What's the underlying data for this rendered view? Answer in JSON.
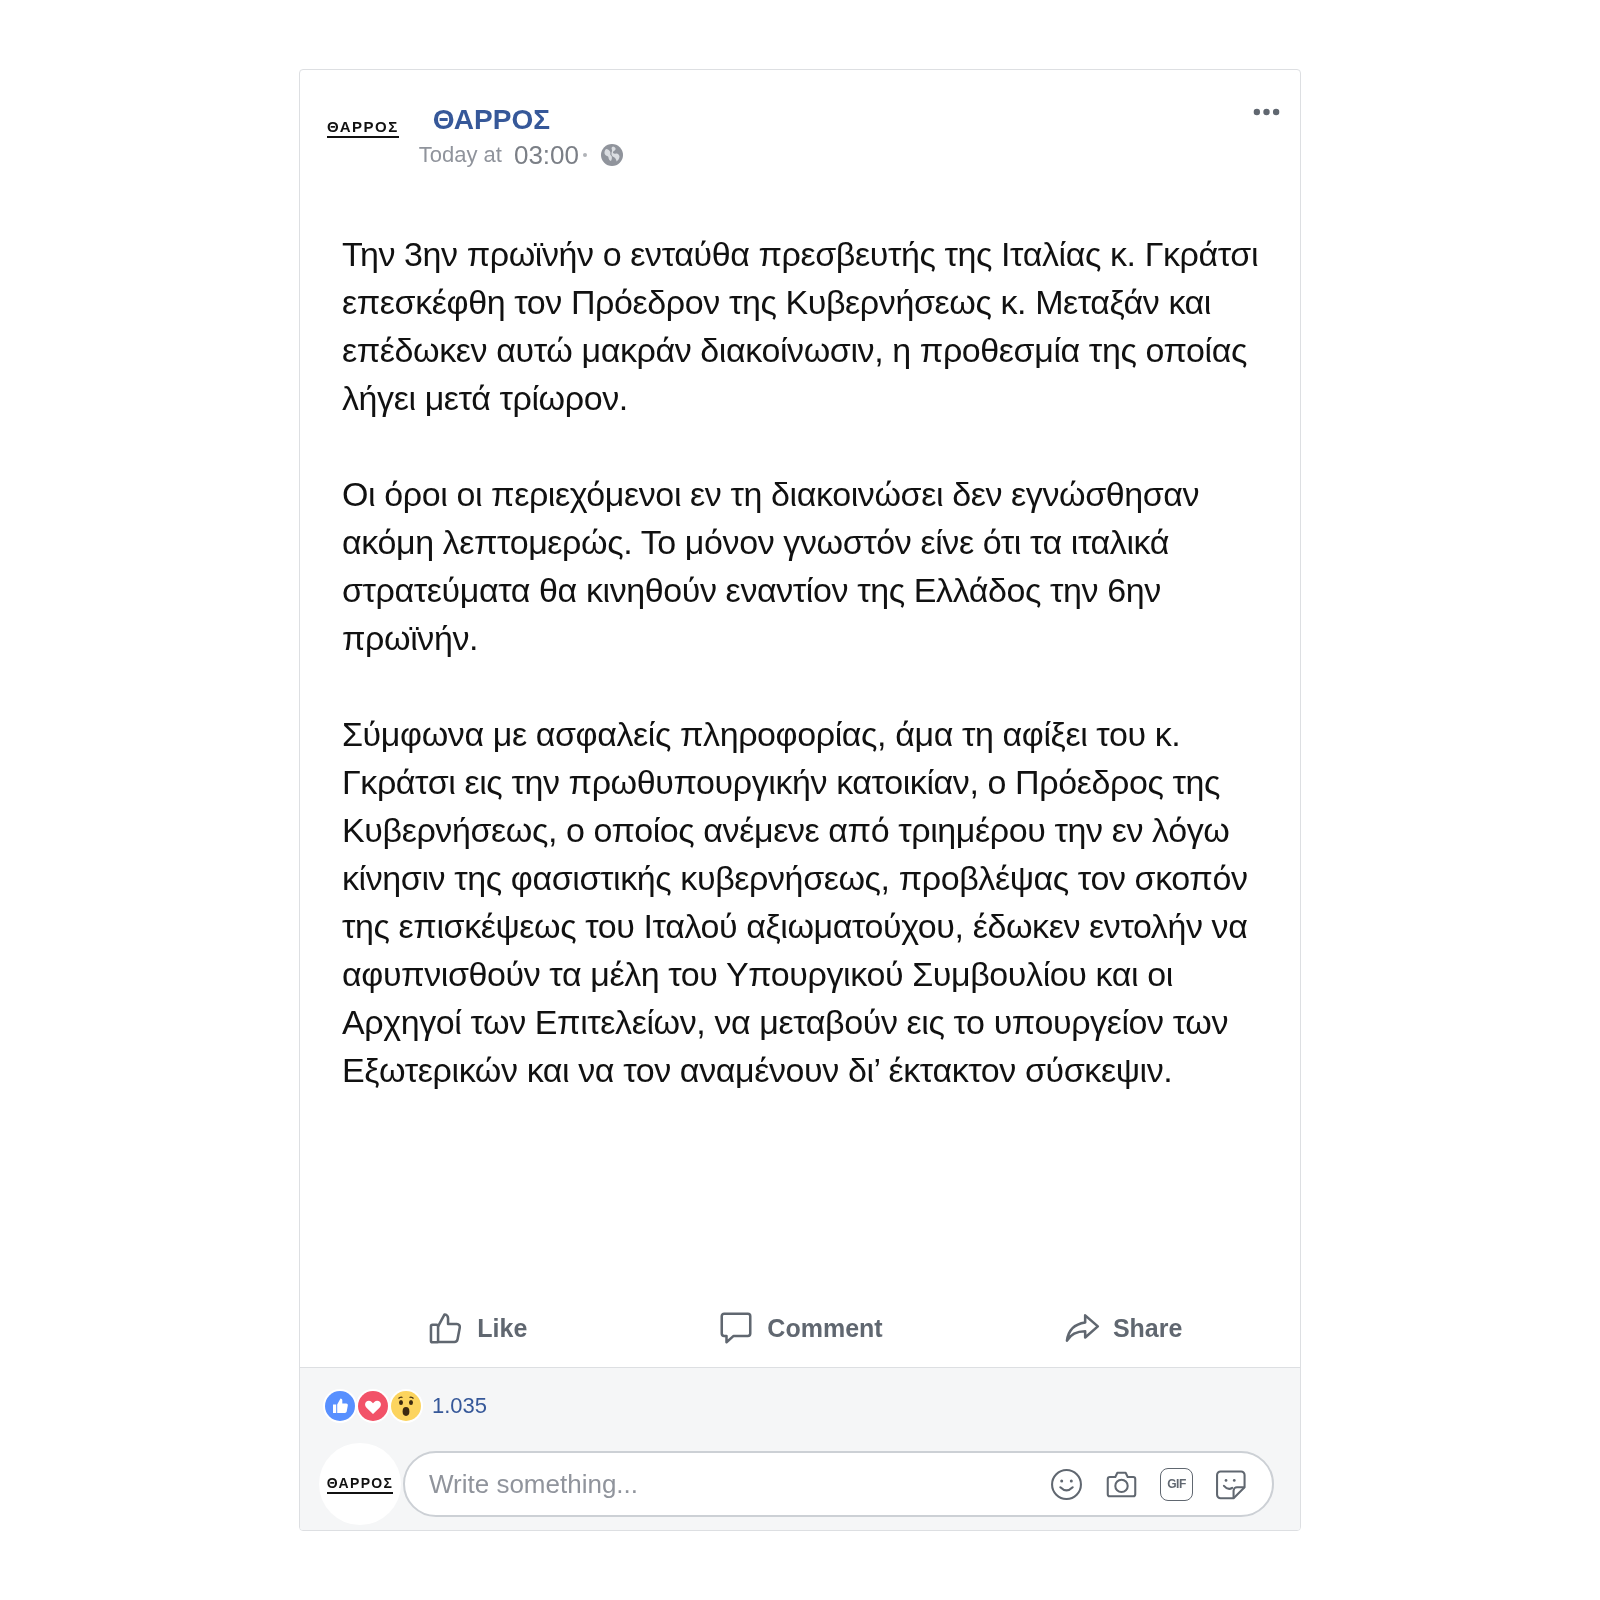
{
  "post": {
    "author": {
      "logo": "ΘΑΡΡΟΣ",
      "name": "ΘΑΡΡΟΣ",
      "time_prefix": "Today at",
      "time": "03:00"
    },
    "paragraphs": [
      "Την 3ην πρωϊνήν ο ενταύθα πρεσβευτής της Ιταλίας κ. Γκράτσι επεσκέφθη τον Πρόεδρον της Κυβερνήσεως κ. Μεταξάν και επέδωκεν αυτώ μακράν διακοίνωσιν, η προθεσμία της οποίας λήγει μετά τρίωρον.",
      "Οι όροι οι περιεχόμενοι εν τη διακοινώσει δεν εγνώσθησαν ακόμη λεπτομερώς. Το μόνον γνωστόν είνε ότι τα ιταλικά στρατεύματα θα κινηθούν εναντίον της Ελλάδος την 6ην πρωϊνήν.",
      "Σύμφωνα με ασφαλείς πληροφορίας, άμα τη αφίξει του κ. Γκράτσι εις την πρωθυπουργικήν κατοικίαν, ο Πρόεδρος της Κυβερνήσεως, ο οποίος ανέμενε από τριημέρου την εν λόγω κίνησιν της φασιστικής κυβερνήσεως, προβλέψας τον σκοπόν της επισκέψεως του Ιταλού αξιωματούχου, έδωκεν εντολήν να αφυπνισθούν τα μέλη του Υπουργικού Συμβουλίου και οι Αρχηγοί των Επιτελείων, να μεταβούν εις το υπουργείον των Εξωτερικών και να τον αναμένουν δι’ έκτακτον σύσκεψιν."
    ],
    "actions": [
      {
        "kind": "like",
        "label": "Like"
      },
      {
        "kind": "comment",
        "label": "Comment"
      },
      {
        "kind": "share",
        "label": "Share"
      }
    ],
    "reactions": {
      "types": [
        {
          "kind": "like"
        },
        {
          "kind": "love"
        },
        {
          "kind": "wow"
        }
      ],
      "count": "1.035"
    },
    "composer": {
      "avatar_logo": "ΘΑΡΡΟΣ",
      "placeholder": "Write something...",
      "tools": [
        {
          "kind": "emoji"
        },
        {
          "kind": "camera"
        },
        {
          "kind": "gif",
          "label": "GIF"
        },
        {
          "kind": "sticker"
        }
      ]
    }
  }
}
